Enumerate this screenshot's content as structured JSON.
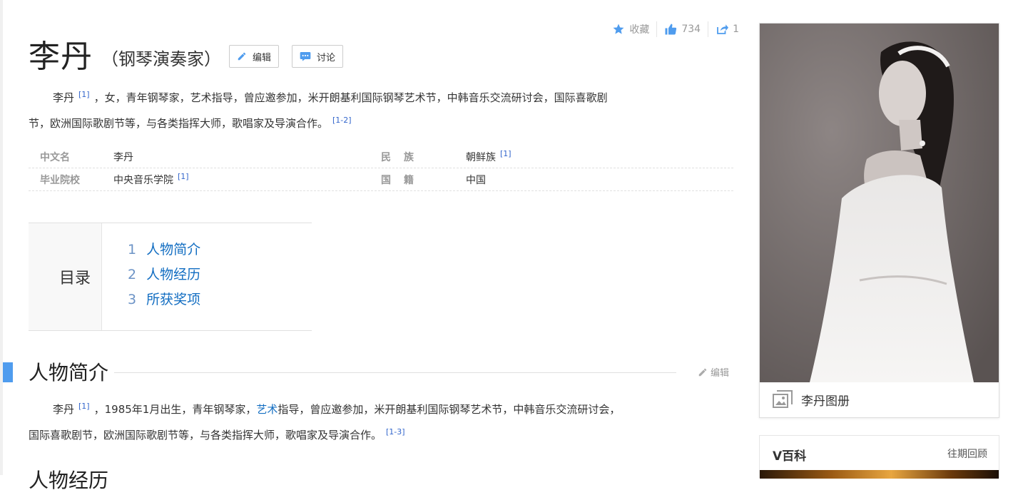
{
  "actions": {
    "favorite_label": "收藏",
    "like_count": "734",
    "share_count": "1"
  },
  "header": {
    "title": "李丹",
    "subtitle": "（钢琴演奏家）",
    "edit_label": "编辑",
    "discuss_label": "讨论"
  },
  "summary": {
    "name": "李丹",
    "ref1": "[1]",
    "line1_rest": "，女，青年钢琴家，艺术指导，曾应邀参加，米开朗基利国际钢琴艺术节，中韩音乐交流研讨会，国际喜歌剧",
    "line2": "节，欧洲国际歌剧节等，与各类指挥大师，歌唱家及导演合作。",
    "ref2": "[1-2]"
  },
  "basic_info": {
    "rows": [
      {
        "k1": "中文名",
        "v1": "李丹",
        "r1": "",
        "k2": "民族",
        "v2": "朝鲜族",
        "r2": "[1]"
      },
      {
        "k1": "毕业院校",
        "v1": "中央音乐学院",
        "r1": "[1]",
        "k2": "国籍",
        "v2": "中国",
        "r2": ""
      }
    ]
  },
  "catalog": {
    "title": "目录",
    "items": [
      {
        "num": "1",
        "label": "人物简介"
      },
      {
        "num": "2",
        "label": "人物经历"
      },
      {
        "num": "3",
        "label": "所获奖项"
      }
    ]
  },
  "section1": {
    "title": "人物简介",
    "edit_label": "编辑",
    "name": "李丹",
    "ref1": "[1]",
    "text_a": "，1985年1月出生，青年钢琴家，",
    "link": "艺术",
    "text_b": "指导，曾应邀参加，米开朗基利国际钢琴艺术节，中韩音乐交流研讨会，",
    "line2": "国际喜歌剧节，欧洲国际歌剧节等，与各类指挥大师，歌唱家及导演合作。",
    "ref2": "[1-3]"
  },
  "section2": {
    "title": "人物经历"
  },
  "album": {
    "caption": "李丹图册"
  },
  "vbaike": {
    "title": "V百科",
    "more": "往期回顾"
  },
  "colors": {
    "link": "#136ec2",
    "section_accent": "#4f9cee",
    "ref": "#3366cc"
  }
}
